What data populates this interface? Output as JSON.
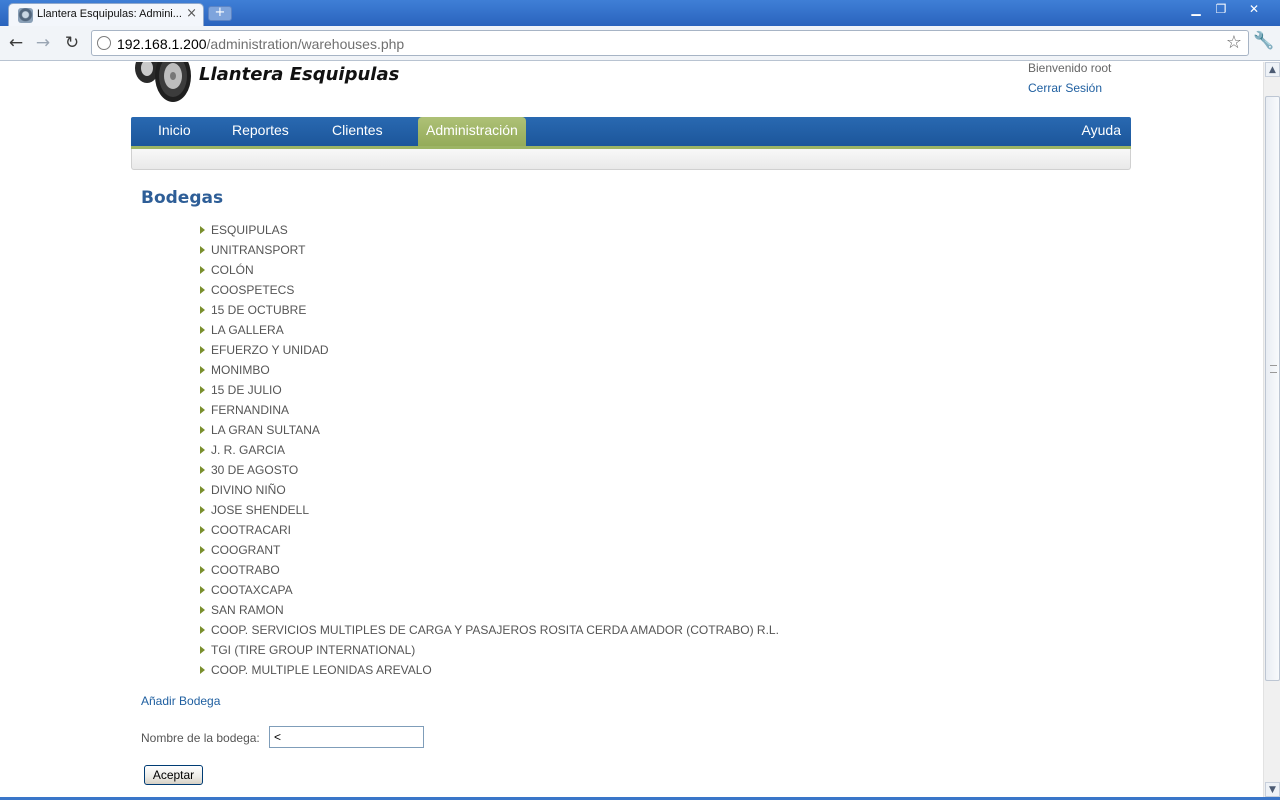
{
  "browser": {
    "tab_title": "Llantera Esquipulas: Admini...",
    "url_host": "192.168.1.200",
    "url_path": "/administration/warehouses.php",
    "icons": [
      "back-arrow-icon",
      "forward-arrow-icon",
      "reload-icon",
      "globe-icon",
      "star-icon",
      "wrench-icon"
    ]
  },
  "header": {
    "site_title": "Llantera Esquipulas",
    "welcome": "Bienvenido root",
    "logout": "Cerrar Sesión"
  },
  "nav": {
    "items": [
      {
        "label": "Inicio"
      },
      {
        "label": "Reportes"
      },
      {
        "label": "Clientes"
      },
      {
        "label": "Administración",
        "active": true
      }
    ],
    "help": "Ayuda"
  },
  "main": {
    "section_title": "Bodegas",
    "warehouses": [
      "ESQUIPULAS",
      "UNITRANSPORT",
      "COLÓN",
      "COOSPETECS",
      "15 DE OCTUBRE",
      "LA GALLERA",
      "EFUERZO Y UNIDAD",
      "MONIMBO",
      "15 DE JULIO",
      "FERNANDINA",
      "LA GRAN SULTANA",
      "J. R. GARCIA",
      "30 DE AGOSTO",
      "DIVINO NIÑO",
      "JOSE SHENDELL",
      "COOTRACARI",
      "COOGRANT",
      "COOTRABO",
      "COOTAXCAPA",
      "SAN RAMON",
      "COOP. SERVICIOS MULTIPLES DE CARGA Y PASAJEROS ROSITA CERDA AMADOR (COTRABO) R.L.",
      "TGI (TIRE GROUP INTERNATIONAL)",
      "COOP. MULTIPLE LEONIDAS AREVALO"
    ],
    "add_link": "Añadir Bodega",
    "form": {
      "label": "Nombre de la bodega:",
      "value": "<",
      "submit": "Aceptar"
    }
  },
  "colors": {
    "nav_blue": "#2969b1",
    "nav_active": "#aec177",
    "title_blue": "#2e5e97",
    "link_blue": "#1f5fa0",
    "bullet_green": "#7a8f2d"
  }
}
